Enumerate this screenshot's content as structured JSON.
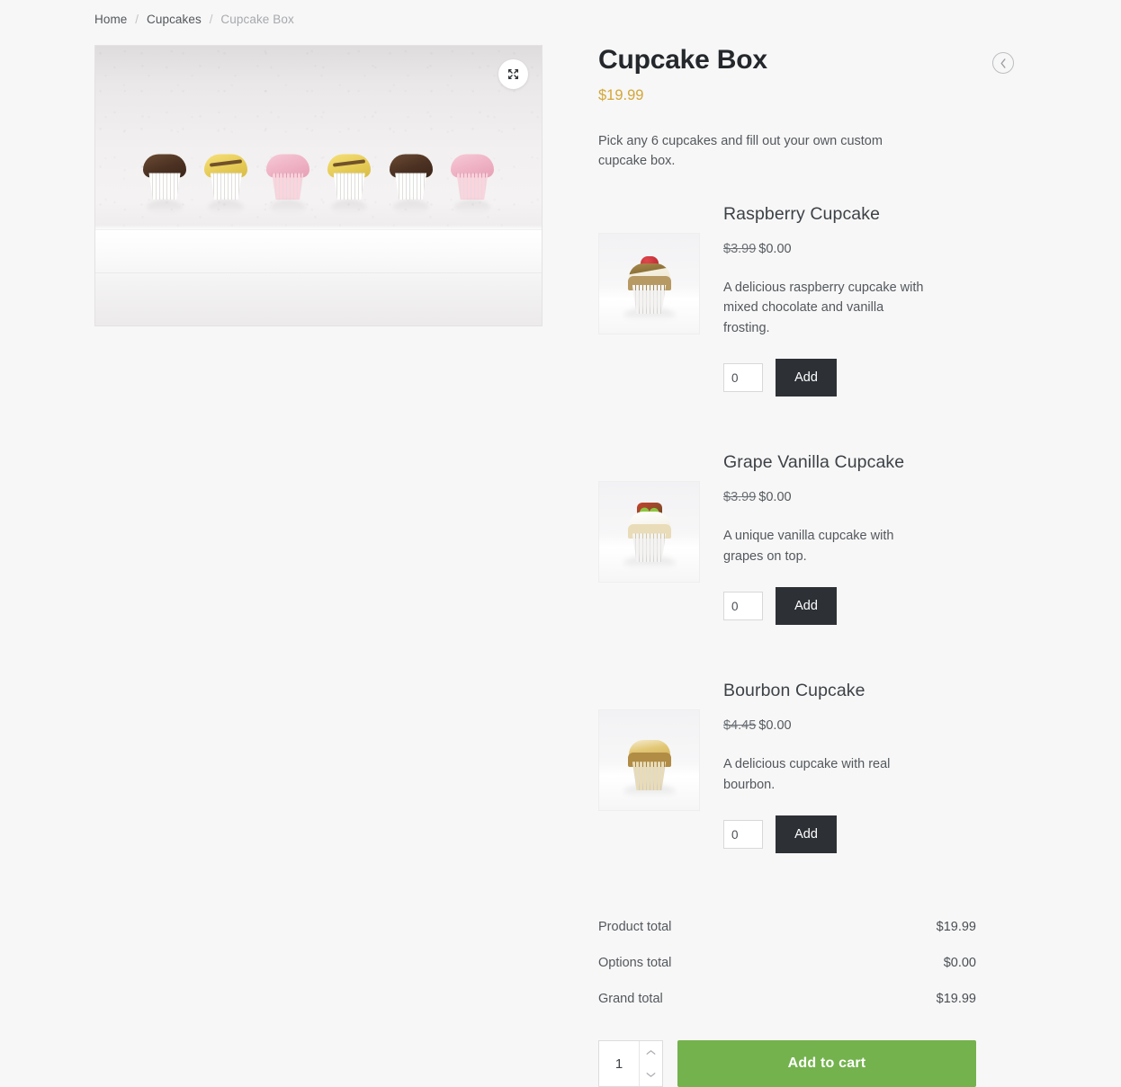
{
  "breadcrumb": {
    "home": "Home",
    "category": "Cupcakes",
    "current": "Cupcake Box",
    "separator": "/"
  },
  "gallery": {
    "expand_icon": "expand-icon",
    "alt": "Six mini cupcakes in a row on a white shelf"
  },
  "product": {
    "title": "Cupcake Box",
    "price": "$19.99",
    "description": "Pick any 6 cupcakes and fill out your own custom cupcake box.",
    "prev_icon": "chevron-left-circle-icon"
  },
  "options": [
    {
      "name": "Raspberry Cupcake",
      "price_old": "$3.99",
      "price_new": "$0.00",
      "description": "A delicious raspberry cupcake with mixed chocolate and vanilla frosting.",
      "qty": "0",
      "add_label": "Add",
      "thumb": "raspberry-cupcake-thumbnail"
    },
    {
      "name": "Grape Vanilla Cupcake",
      "price_old": "$3.99",
      "price_new": "$0.00",
      "description": "A unique vanilla cupcake with grapes on top.",
      "qty": "0",
      "add_label": "Add",
      "thumb": "grape-vanilla-cupcake-thumbnail"
    },
    {
      "name": "Bourbon Cupcake",
      "price_old": "$4.45",
      "price_new": "$0.00",
      "description": "A delicious cupcake with real bourbon.",
      "qty": "0",
      "add_label": "Add",
      "thumb": "bourbon-cupcake-thumbnail"
    }
  ],
  "totals": [
    {
      "label": "Product total",
      "value": "$19.99"
    },
    {
      "label": "Options total",
      "value": "$0.00"
    },
    {
      "label": "Grand total",
      "value": "$19.99"
    }
  ],
  "cart": {
    "quantity": "1",
    "add_to_cart_label": "Add to cart",
    "increase_icon": "chevron-up-icon",
    "decrease_icon": "chevron-down-icon"
  },
  "colors": {
    "page_background": "#f7f7f7",
    "price_accent": "#d3a738",
    "add_button": "#2d3136",
    "add_to_cart_button": "#73b24d",
    "text": "#53585d",
    "title": "#24282c"
  }
}
